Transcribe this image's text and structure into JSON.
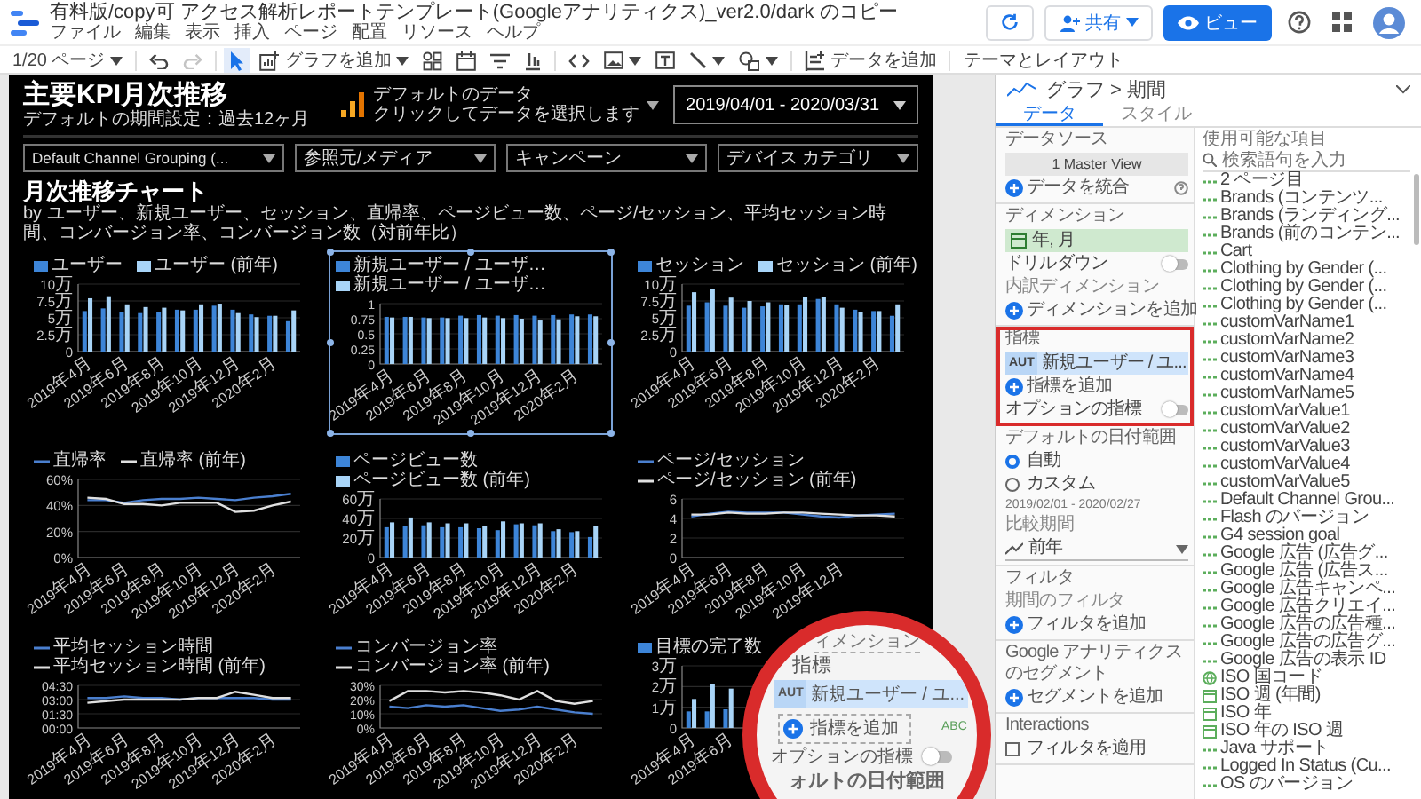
{
  "app": {
    "title": "有料版/copy可 アクセス解析レポートテンプレート(Googleアナリティクス)_ver2.0/dark のコピー",
    "menu": [
      "ファイル",
      "編集",
      "表示",
      "挿入",
      "ページ",
      "配置",
      "リソース",
      "ヘルプ"
    ],
    "actions": [
      {
        "kind": "refresh"
      },
      {
        "kind": "share",
        "label": "共有"
      },
      {
        "kind": "view",
        "label": "ビュー"
      },
      {
        "kind": "help"
      },
      {
        "kind": "apps"
      },
      {
        "kind": "account"
      }
    ]
  },
  "toolbar": [
    {
      "kind": "pages",
      "label": "1/20 ページ",
      "selected": false,
      "disabled": false
    },
    {
      "kind": "undo",
      "selected": false,
      "disabled": false
    },
    {
      "kind": "redo",
      "selected": false,
      "disabled": true
    },
    {
      "kind": "pointer",
      "selected": true,
      "disabled": false
    },
    {
      "kind": "add-chart",
      "label": "グラフを追加",
      "selected": false,
      "disabled": false
    },
    {
      "kind": "components",
      "selected": false,
      "disabled": false
    },
    {
      "kind": "date",
      "selected": false,
      "disabled": false
    },
    {
      "kind": "filter",
      "selected": false,
      "disabled": false
    },
    {
      "kind": "data-control",
      "selected": false,
      "disabled": false
    },
    {
      "kind": "code",
      "selected": false,
      "disabled": false
    },
    {
      "kind": "image",
      "selected": false,
      "disabled": false
    },
    {
      "kind": "text",
      "selected": false,
      "disabled": false
    },
    {
      "kind": "line",
      "selected": false,
      "disabled": false
    },
    {
      "kind": "shape",
      "selected": false,
      "disabled": false
    },
    {
      "kind": "add-data",
      "label": "データを追加",
      "selected": false,
      "disabled": false
    },
    {
      "kind": "theme",
      "label": "テーマとレイアウト",
      "selected": false,
      "disabled": false
    }
  ],
  "report": {
    "title": "主要KPI月次推移",
    "subtitle": "デフォルトの期間設定：過去12ヶ月",
    "data_source": {
      "line1": "デフォルトのデータ",
      "line2": "クリックしてデータを選択します"
    },
    "date_range": "2019/04/01 - 2020/03/31",
    "filters": [
      "Default Channel Grouping (...",
      "参照元/メディア",
      "キャンペーン",
      "デバイス カテゴリ"
    ],
    "section_title": "月次推移チャート",
    "section_subtitle": "by ユーザー、新規ユーザー、セッション、直帰率、ページビュー数、ページ/セッション、平均セッション時間、コンバージョン率、コンバージョン数（対前年比）",
    "charts": [
      {
        "selected": false,
        "chart_data": {
          "type": "bar",
          "legend": "top",
          "grid": true,
          "categories": [
            "2019年4月",
            null,
            "2019年6月",
            null,
            "2019年8月",
            null,
            "2019年10月",
            null,
            "2019年12月",
            null,
            "2020年2月",
            null
          ],
          "ylim": [
            0,
            10
          ],
          "yticks": [
            {
              "value": 0,
              "label": "0"
            },
            {
              "value": 2.5,
              "label": "2.5万"
            },
            {
              "value": 5,
              "label": "5万"
            },
            {
              "value": 7.5,
              "label": "7.5万"
            },
            {
              "value": 10,
              "label": "10万"
            }
          ],
          "series": [
            {
              "name": "ユーザー",
              "color": "#3d85d8",
              "values": [
                6,
                6.4,
                5.9,
                5.7,
                5.9,
                6.2,
                6.2,
                6.8,
                6.2,
                5.5,
                5.3,
                4.5
              ]
            },
            {
              "name": "ユーザー (前年)",
              "color": "#a8d4f7",
              "values": [
                7.9,
                8.2,
                7,
                6.6,
                6.5,
                6.1,
                7,
                7.1,
                5.7,
                5.1,
                5.3,
                6.1
              ]
            }
          ]
        }
      },
      {
        "selected": true,
        "chart_data": {
          "type": "bar",
          "legend": "top",
          "grid": true,
          "categories": [
            "2019年4月",
            null,
            "2019年6月",
            null,
            "2019年8月",
            null,
            "2019年10月",
            null,
            "2019年12月",
            null,
            "2020年2月",
            null
          ],
          "ylim": [
            0,
            1
          ],
          "yticks": [
            {
              "value": 0,
              "label": "0"
            },
            {
              "value": 0.25,
              "label": "0.25"
            },
            {
              "value": 0.5,
              "label": "0.5"
            },
            {
              "value": 0.75,
              "label": "0.75"
            },
            {
              "value": 1,
              "label": "1"
            }
          ],
          "series": [
            {
              "name": "新規ユーザー / ユーザ…",
              "color": "#3d85d8",
              "values": [
                0.78,
                0.78,
                0.77,
                0.77,
                0.8,
                0.81,
                0.8,
                0.81,
                0.8,
                0.81,
                0.82,
                0.82
              ]
            },
            {
              "name": "新規ユーザー / ユーザ…",
              "color": "#a8d4f7",
              "values": [
                0.77,
                0.78,
                0.76,
                0.76,
                0.76,
                0.77,
                0.76,
                0.75,
                0.72,
                0.74,
                0.79,
                0.79
              ]
            }
          ]
        }
      },
      {
        "selected": false,
        "chart_data": {
          "type": "bar",
          "legend": "top",
          "grid": true,
          "categories": [
            "2019年4月",
            null,
            "2019年6月",
            null,
            "2019年8月",
            null,
            "2019年10月",
            null,
            "2019年12月",
            null,
            "2020年2月",
            null
          ],
          "ylim": [
            0,
            10
          ],
          "yticks": [
            {
              "value": 0,
              "label": "0"
            },
            {
              "value": 2.5,
              "label": "2.5万"
            },
            {
              "value": 5,
              "label": "5万"
            },
            {
              "value": 7.5,
              "label": "7.5万"
            },
            {
              "value": 10,
              "label": "10万"
            }
          ],
          "series": [
            {
              "name": "セッション",
              "color": "#3d85d8",
              "values": [
                6.8,
                7.3,
                6.8,
                6.5,
                6.7,
                7,
                7,
                7.8,
                7,
                6.2,
                6,
                5.3
              ]
            },
            {
              "name": "セッション (前年)",
              "color": "#a8d4f7",
              "values": [
                8.8,
                9.3,
                8,
                7.5,
                7.3,
                6.9,
                8.1,
                8.1,
                6.5,
                5.8,
                6,
                7
              ]
            }
          ]
        }
      },
      {
        "selected": false,
        "chart_data": {
          "type": "line",
          "legend": "top",
          "grid": true,
          "categories": [
            "2019年4月",
            null,
            "2019年6月",
            null,
            "2019年8月",
            null,
            "2019年10月",
            null,
            "2019年12月",
            null,
            "2020年2月",
            null
          ],
          "ylim": [
            0,
            60
          ],
          "yticks": [
            {
              "value": 0,
              "label": "0%"
            },
            {
              "value": 20,
              "label": "20%"
            },
            {
              "value": 40,
              "label": "40%"
            },
            {
              "value": 60,
              "label": "60%"
            }
          ],
          "series": [
            {
              "name": "直帰率",
              "color": "#4a7fcf",
              "values": [
                44,
                44,
                42,
                44,
                45,
                45,
                46,
                45,
                44,
                46,
                47,
                49
              ]
            },
            {
              "name": "直帰率 (前年)",
              "color": "#e0e0e0",
              "values": [
                46,
                45,
                41,
                41,
                40,
                42,
                42,
                42,
                35,
                36,
                40,
                43
              ]
            }
          ]
        }
      },
      {
        "selected": false,
        "chart_data": {
          "type": "bar",
          "legend": "top",
          "grid": true,
          "categories": [
            "2019年4月",
            null,
            "2019年6月",
            null,
            "2019年8月",
            null,
            "2019年10月",
            null,
            "2019年12月",
            null,
            "2020年2月",
            null
          ],
          "ylim": [
            0,
            60
          ],
          "yticks": [
            {
              "value": 0,
              "label": "0"
            },
            {
              "value": 20,
              "label": "20万"
            },
            {
              "value": 40,
              "label": "40万"
            },
            {
              "value": 60,
              "label": "60万"
            }
          ],
          "series": [
            {
              "name": "ページビュー数",
              "color": "#3d85d8",
              "values": [
                31,
                32,
                33,
                31,
                31,
                30,
                28,
                34,
                33,
                27,
                26,
                21
              ]
            },
            {
              "name": "ページビュー数 (前年)",
              "color": "#a8d4f7",
              "values": [
                36,
                41,
                36,
                35,
                35,
                32,
                37,
                35,
                35,
                29,
                27,
                32
              ]
            }
          ]
        }
      },
      {
        "selected": false,
        "chart_data": {
          "type": "line",
          "legend": "top",
          "grid": true,
          "categories": [
            "2019年4月",
            null,
            "2019年6月",
            null,
            "2019年8月",
            null,
            "2019年10月",
            null,
            "2019年12月",
            null,
            null,
            null
          ],
          "ylim": [
            0,
            6
          ],
          "yticks": [
            {
              "value": 0,
              "label": "0"
            },
            {
              "value": 2,
              "label": "2"
            },
            {
              "value": 4,
              "label": "4"
            },
            {
              "value": 6,
              "label": "6"
            }
          ],
          "series": [
            {
              "name": "ページ/セッション",
              "color": "#4a7fcf",
              "values": [
                4.2,
                4.5,
                4.7,
                4.6,
                4.6,
                4.6,
                4.4,
                4.2,
                4.1,
                4.3,
                4.4,
                4.5
              ]
            },
            {
              "name": "ページ/セッション (前年)",
              "color": "#e0e0e0",
              "values": [
                4.4,
                4.4,
                4.6,
                4.5,
                4.5,
                4.6,
                4.6,
                4.5,
                4.4,
                4.3,
                4.3,
                4.2
              ]
            }
          ]
        }
      },
      {
        "selected": false,
        "chart_data": {
          "type": "line",
          "legend": "top",
          "grid": true,
          "categories": [
            "2019年4月",
            null,
            "2019年6月",
            null,
            "2019年8月",
            null,
            "2019年10月",
            null,
            "2019年12月",
            null,
            "2020年2月",
            null
          ],
          "ylim": [
            0,
            270
          ],
          "yticks": [
            {
              "value": 0,
              "label": "00:00"
            },
            {
              "value": 90,
              "label": "01:30"
            },
            {
              "value": 180,
              "label": "03:00"
            },
            {
              "value": 270,
              "label": "04:30"
            }
          ],
          "series": [
            {
              "name": "平均セッション時間",
              "color": "#4a7fcf",
              "values": [
                190,
                190,
                200,
                190,
                190,
                180,
                190,
                190,
                190,
                190,
                180,
                180
              ]
            },
            {
              "name": "平均セッション時間 (前年)",
              "color": "#e0e0e0",
              "values": [
                160,
                170,
                180,
                180,
                180,
                180,
                190,
                190,
                230,
                210,
                190,
                190
              ]
            }
          ]
        }
      },
      {
        "selected": false,
        "chart_data": {
          "type": "line",
          "legend": "top",
          "grid": true,
          "categories": [
            "2019年4月",
            null,
            "2019年6月",
            null,
            "2019年8月",
            null,
            "2019年10月",
            null,
            "2019年12月",
            null,
            "2020年2月",
            null
          ],
          "ylim": [
            0,
            30
          ],
          "yticks": [
            {
              "value": 0,
              "label": "0%"
            },
            {
              "value": 10,
              "label": "10%"
            },
            {
              "value": 20,
              "label": "20%"
            },
            {
              "value": 30,
              "label": "30%"
            }
          ],
          "series": [
            {
              "name": "コンバージョン率",
              "color": "#4a7fcf",
              "values": [
                15,
                14,
                16,
                15,
                16,
                14,
                12,
                13,
                15,
                13,
                11,
                10
              ]
            },
            {
              "name": "コンバージョン率 (前年)",
              "color": "#e0e0e0",
              "values": [
                19,
                26,
                26,
                25,
                26,
                25,
                23,
                20,
                26,
                19,
                17,
                19
              ]
            }
          ]
        }
      },
      {
        "selected": false,
        "chart_data": {
          "type": "bar",
          "legend": "top",
          "grid": true,
          "categories": [
            "2019年4月",
            null,
            "2019年6月",
            null,
            null,
            null,
            null,
            null,
            null,
            null,
            null,
            null
          ],
          "ylim": [
            0,
            3
          ],
          "yticks": [
            {
              "value": 0,
              "label": "0"
            },
            {
              "value": 1,
              "label": "1万"
            },
            {
              "value": 2,
              "label": "2万"
            },
            {
              "value": 3,
              "label": "3万"
            }
          ],
          "series": [
            {
              "name": "目標の完了数",
              "color": "#3d85d8",
              "values": [
                0.8,
                0.8,
                0.9,
                null,
                null,
                null,
                null,
                null,
                null,
                null,
                null,
                null
              ]
            },
            {
              "color": "#a8d4f7",
              "values": [
                1.4,
                2.1,
                1.9,
                null,
                null,
                null,
                null,
                null,
                null,
                null,
                null,
                null
              ]
            }
          ]
        }
      }
    ]
  },
  "panel": {
    "header": "グラフ > 期間",
    "tabs": [
      {
        "label": "データ",
        "selected": true
      },
      {
        "label": "スタイル",
        "selected": false
      }
    ],
    "sections": [
      {
        "highlighted": false,
        "items": [
          {
            "kind": "heading",
            "text": "データソース"
          },
          {
            "kind": "source",
            "text": "1 Master View"
          },
          {
            "kind": "add",
            "text": "データを統合",
            "help": true
          }
        ]
      },
      {
        "highlighted": false,
        "items": [
          {
            "kind": "heading",
            "text": "ディメンション"
          },
          {
            "kind": "dimension",
            "text": "年, 月"
          },
          {
            "kind": "toggle",
            "text": "ドリルダウン",
            "on": false
          },
          {
            "kind": "subheading",
            "text": "内訳ディメンション"
          },
          {
            "kind": "add",
            "text": "ディメンションを追加",
            "help": false
          }
        ]
      },
      {
        "highlighted": true,
        "items": [
          {
            "kind": "heading",
            "text": "指標"
          },
          {
            "kind": "metric",
            "badge": "AUT",
            "text": "新規ユーザー / ユ..."
          },
          {
            "kind": "add",
            "text": "指標を追加",
            "help": false
          },
          {
            "kind": "toggle",
            "text": "オプションの指標",
            "on": false
          }
        ]
      },
      {
        "highlighted": false,
        "items": [
          {
            "kind": "heading",
            "text": "デフォルトの日付範囲"
          },
          {
            "kind": "radio",
            "text": "自動",
            "selected": true
          },
          {
            "kind": "radio",
            "text": "カスタム",
            "selected": false
          },
          {
            "kind": "note",
            "text": "2019/02/01 - 2020/02/27"
          },
          {
            "kind": "subheading",
            "text": "比較期間"
          },
          {
            "kind": "select",
            "text": "前年"
          }
        ]
      },
      {
        "highlighted": false,
        "items": [
          {
            "kind": "heading",
            "text": "フィルタ"
          },
          {
            "kind": "subheading",
            "text": "期間のフィルタ"
          },
          {
            "kind": "add",
            "text": "フィルタを追加",
            "help": false
          }
        ]
      },
      {
        "highlighted": false,
        "items": [
          {
            "kind": "heading",
            "text": "Google アナリティクスのセグメント"
          },
          {
            "kind": "add",
            "text": "セグメントを追加",
            "help": false
          }
        ]
      },
      {
        "highlighted": false,
        "items": [
          {
            "kind": "heading",
            "text": "Interactions"
          },
          {
            "kind": "checkbox",
            "text": "フィルタを適用",
            "checked": false
          }
        ]
      }
    ],
    "fields_heading": "使用可能な項目",
    "search": {
      "placeholder": "検索語句を入力"
    },
    "fields": [
      {
        "kind": "text",
        "name": "2 ページ目"
      },
      {
        "kind": "text",
        "name": "Brands (コンテンツ..."
      },
      {
        "kind": "text",
        "name": "Brands (ランディング..."
      },
      {
        "kind": "text",
        "name": "Brands (前のコンテン..."
      },
      {
        "kind": "text",
        "name": "Cart"
      },
      {
        "kind": "text",
        "name": "Clothing by Gender (..."
      },
      {
        "kind": "text",
        "name": "Clothing by Gender (..."
      },
      {
        "kind": "text",
        "name": "Clothing by Gender (..."
      },
      {
        "kind": "text",
        "name": "customVarName1"
      },
      {
        "kind": "text",
        "name": "customVarName2"
      },
      {
        "kind": "text",
        "name": "customVarName3"
      },
      {
        "kind": "text",
        "name": "customVarName4"
      },
      {
        "kind": "text",
        "name": "customVarName5"
      },
      {
        "kind": "text",
        "name": "customVarValue1"
      },
      {
        "kind": "text",
        "name": "customVarValue2"
      },
      {
        "kind": "text",
        "name": "customVarValue3"
      },
      {
        "kind": "text",
        "name": "customVarValue4"
      },
      {
        "kind": "text",
        "name": "customVarValue5"
      },
      {
        "kind": "text",
        "name": "Default Channel Grou..."
      },
      {
        "kind": "text",
        "name": "Flash のバージョン"
      },
      {
        "kind": "text",
        "name": "G4 session goal"
      },
      {
        "kind": "text",
        "name": "Google 広告 (広告グ..."
      },
      {
        "kind": "text",
        "name": "Google 広告 (広告ス..."
      },
      {
        "kind": "text",
        "name": "Google 広告キャンペ..."
      },
      {
        "kind": "text",
        "name": "Google 広告クリエイ..."
      },
      {
        "kind": "text",
        "name": "Google 広告の広告種..."
      },
      {
        "kind": "text",
        "name": "Google 広告の広告グ..."
      },
      {
        "kind": "text",
        "name": "Google 広告の表示 ID"
      },
      {
        "kind": "geo",
        "name": "ISO 国コード"
      },
      {
        "kind": "date",
        "name": "ISO 週 (年間)"
      },
      {
        "kind": "date",
        "name": "ISO 年"
      },
      {
        "kind": "date",
        "name": "ISO 年の ISO 週"
      },
      {
        "kind": "text",
        "name": "Java サポート"
      },
      {
        "kind": "text",
        "name": "Logged In Status (Cu..."
      },
      {
        "kind": "text",
        "name": "OS のバージョン"
      }
    ]
  },
  "magnifier": {
    "top_partial": "ィメンション",
    "heading": "指標",
    "badge": "AUT",
    "metric": "新規ユーザー / ユ...",
    "add": "指標を追加",
    "toggle": "オプションの指標",
    "toggle_on": false,
    "bottom_partial": "ォルトの日付範囲",
    "field_types": [
      "ABC"
    ]
  }
}
